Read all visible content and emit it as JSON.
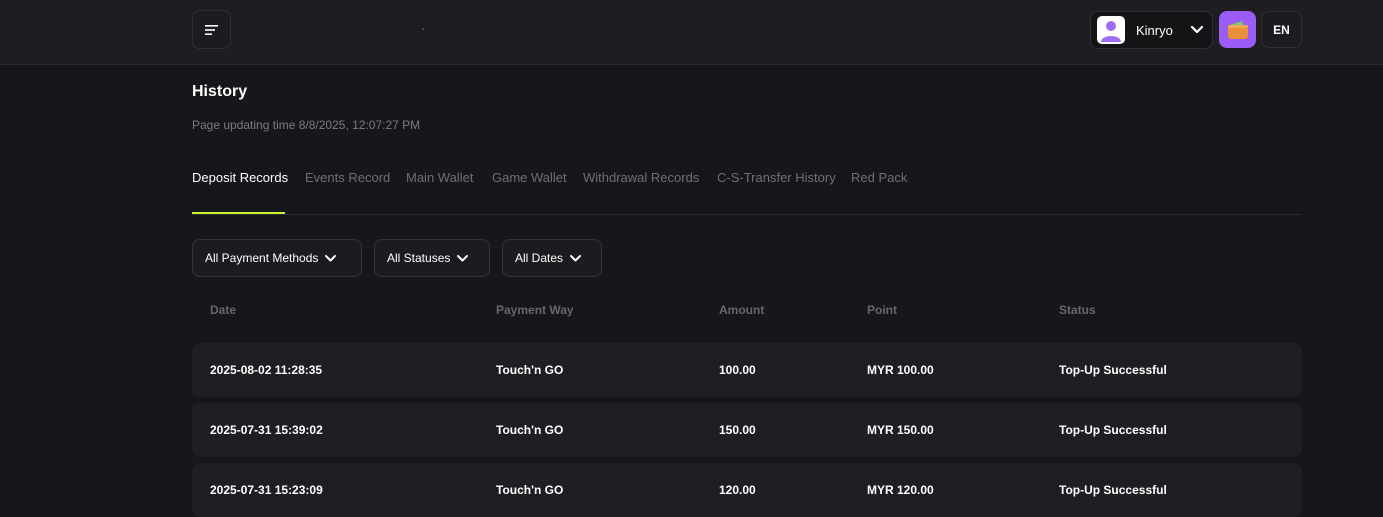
{
  "header": {
    "username": "Kinryo",
    "language": "EN"
  },
  "page": {
    "title": "History",
    "update_time": "Page updating time 8/8/2025, 12:07:27 PM"
  },
  "tabs": [
    {
      "label": "Deposit Records",
      "active": true
    },
    {
      "label": "Events Record"
    },
    {
      "label": "Main Wallet"
    },
    {
      "label": "Game Wallet"
    },
    {
      "label": "Withdrawal Records"
    },
    {
      "label": "C-S-Transfer History"
    },
    {
      "label": "Red Pack"
    }
  ],
  "filters": {
    "payment_methods": "All Payment Methods",
    "statuses": "All Statuses",
    "dates": "All Dates"
  },
  "table": {
    "columns": [
      "Date",
      "Payment Way",
      "Amount",
      "Point",
      "Status"
    ],
    "rows": [
      {
        "date": "2025-08-02 11:28:35",
        "payment_way": "Touch'n GO",
        "amount": "100.00",
        "point": "MYR 100.00",
        "status": "Top-Up Successful"
      },
      {
        "date": "2025-07-31 15:39:02",
        "payment_way": "Touch'n GO",
        "amount": "150.00",
        "point": "MYR 150.00",
        "status": "Top-Up Successful"
      },
      {
        "date": "2025-07-31 15:23:09",
        "payment_way": "Touch'n GO",
        "amount": "120.00",
        "point": "MYR 120.00",
        "status": "Top-Up Successful"
      }
    ]
  },
  "colors": {
    "accent": "#c6f432",
    "wallet": "#9b5cf6",
    "background": "#17171b"
  }
}
